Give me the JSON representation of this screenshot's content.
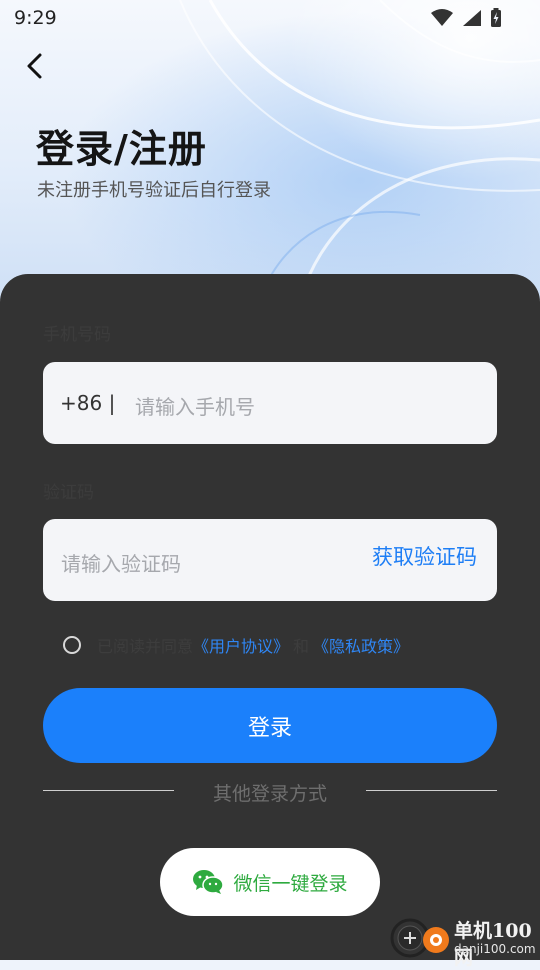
{
  "status_bar": {
    "time": "9:29"
  },
  "header": {
    "title": "登录/注册",
    "subtitle": "未注册手机号验证后自行登录"
  },
  "phone": {
    "label": "手机号码",
    "prefix": "+86 |",
    "placeholder": "请输入手机号"
  },
  "code": {
    "label": "验证码",
    "placeholder": "请输入验证码",
    "get_code_label": "获取验证码"
  },
  "agreement": {
    "text": "已阅读并同意",
    "user_agreement": "《用户协议》",
    "and": "和",
    "privacy_policy": "《隐私政策》"
  },
  "login_button": "登录",
  "other_login_label": "其他登录方式",
  "wechat_login_label": "微信一键登录",
  "watermark": {
    "line1": "单机100网",
    "line2": "danji100.com"
  },
  "colors": {
    "primary": "#1b80fb",
    "card_background": "#333333",
    "wechat_green": "#2eaa3f",
    "link": "#2f86f4"
  },
  "icons": [
    "wifi-icon",
    "signal-icon",
    "battery-charging-icon",
    "back-arrow-icon",
    "wechat-icon",
    "watermark-logo-icon"
  ]
}
